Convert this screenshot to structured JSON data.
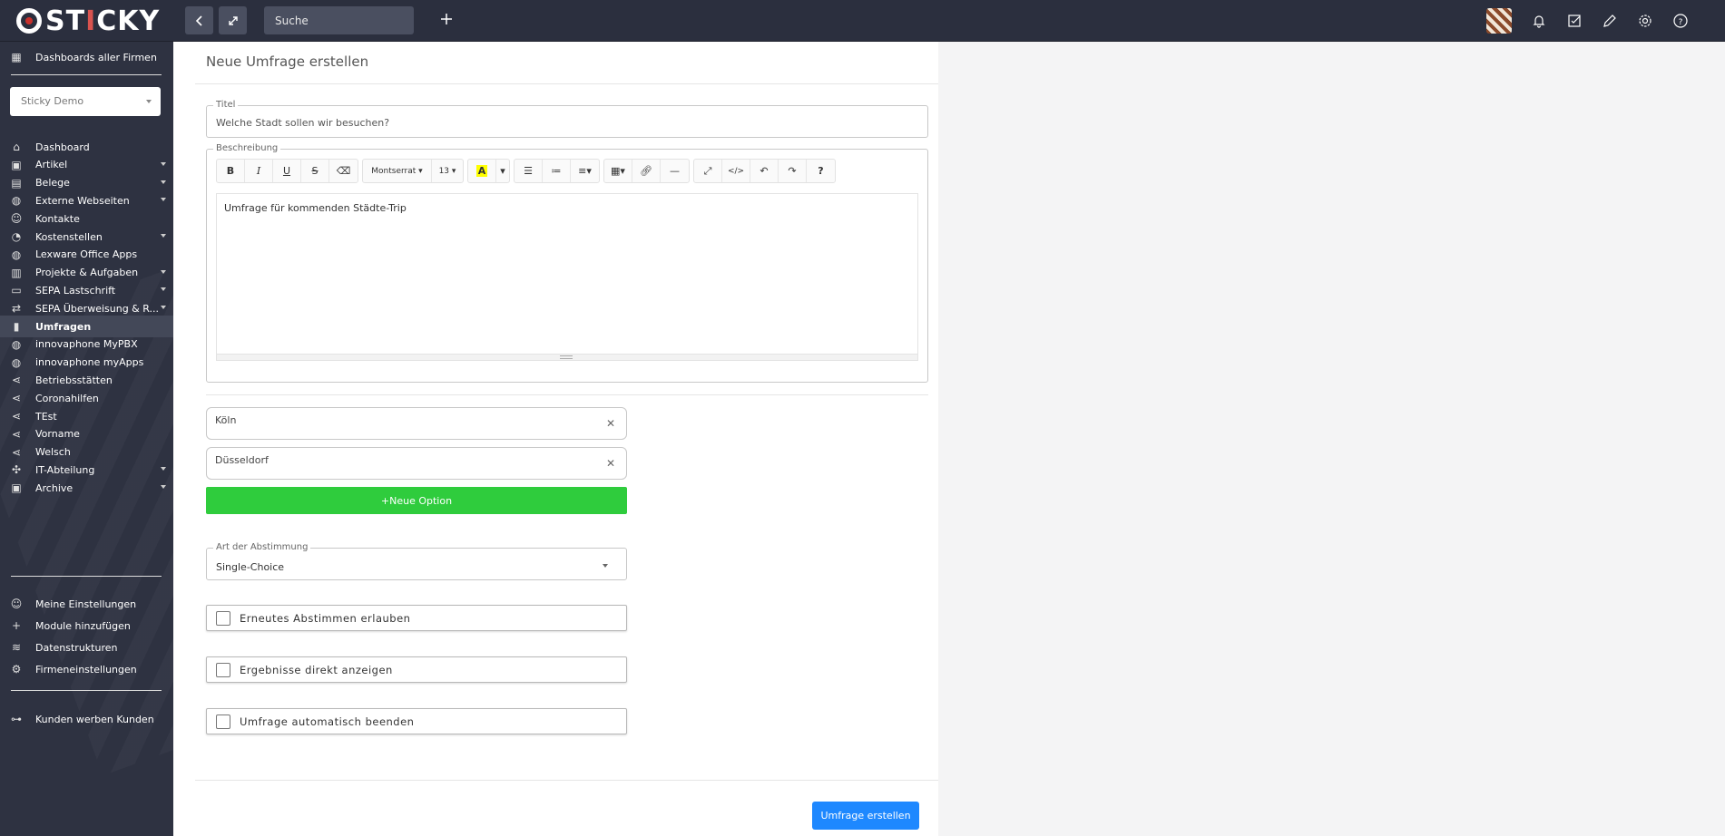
{
  "topbar": {
    "logo_text_a": "ST",
    "logo_text_b": "I",
    "logo_text_c": "CKY",
    "search_placeholder": "Suche",
    "icons": [
      "back-icon",
      "expand-icon",
      "plus-icon",
      "avatar",
      "bell-icon",
      "checkbox-icon",
      "pencil-icon",
      "gear-icon",
      "help-icon"
    ]
  },
  "sidebar": {
    "top_item": "Dashboards aller Firmen",
    "company": "Sticky Demo",
    "items": [
      {
        "label": "Dashboard",
        "icon": "home-icon",
        "caret": false
      },
      {
        "label": "Artikel",
        "icon": "box-icon",
        "caret": true
      },
      {
        "label": "Belege",
        "icon": "document-icon",
        "caret": true
      },
      {
        "label": "Externe Webseiten",
        "icon": "globe-icon",
        "caret": true
      },
      {
        "label": "Kontakte",
        "icon": "contact-icon",
        "caret": false
      },
      {
        "label": "Kostenstellen",
        "icon": "pie-icon",
        "caret": true
      },
      {
        "label": "Lexware Office Apps",
        "icon": "globe-icon",
        "caret": false
      },
      {
        "label": "Projekte & Aufgaben",
        "icon": "project-icon",
        "caret": true
      },
      {
        "label": "SEPA Lastschrift",
        "icon": "card-icon",
        "caret": true
      },
      {
        "label": "SEPA Überweisung & R...",
        "icon": "transfer-icon",
        "caret": true
      },
      {
        "label": "Umfragen",
        "icon": "chart-icon",
        "caret": false,
        "active": true
      },
      {
        "label": "innovaphone MyPBX",
        "icon": "globe-icon",
        "caret": false
      },
      {
        "label": "innovaphone myApps",
        "icon": "globe-icon",
        "caret": false
      },
      {
        "label": "Betriebsstätten",
        "icon": "share-icon",
        "caret": false
      },
      {
        "label": "Coronahilfen",
        "icon": "share-icon",
        "caret": false
      },
      {
        "label": "TEst",
        "icon": "share-icon",
        "caret": false
      },
      {
        "label": "Vorname",
        "icon": "share-icon",
        "caret": false
      },
      {
        "label": "Welsch",
        "icon": "share-icon",
        "caret": false
      },
      {
        "label": "IT-Abteilung",
        "icon": "network-icon",
        "caret": true
      },
      {
        "label": "Archive",
        "icon": "archive-icon",
        "caret": true
      }
    ],
    "bottom_items": [
      {
        "label": "Meine Einstellungen",
        "icon": "user-settings-icon"
      },
      {
        "label": "Module hinzufügen",
        "icon": "plus-icon"
      },
      {
        "label": "Datenstrukturen",
        "icon": "database-icon"
      },
      {
        "label": "Firmeneinstellungen",
        "icon": "gear-icon"
      }
    ],
    "referral": {
      "label": "Kunden werben Kunden",
      "icon": "hierarchy-icon"
    }
  },
  "form": {
    "page_title": "Neue Umfrage erstellen",
    "title_label": "Titel",
    "title_value": "Welche Stadt sollen wir besuchen?",
    "description_label": "Beschreibung",
    "toolbar": {
      "font_name": "Montserrat",
      "font_size": "13"
    },
    "description_text": "Umfrage für kommenden Städte-Trip",
    "options": [
      "Köln",
      "Düsseldorf"
    ],
    "new_option_label": "+Neue Option",
    "vote_type_label": "Art der Abstimmung",
    "vote_type_value": "Single-Choice",
    "checkboxes": [
      "Erneutes Abstimmen erlauben",
      "Ergebnisse direkt anzeigen",
      "Umfrage automatisch beenden"
    ],
    "submit_label": "Umfrage erstellen"
  },
  "colors": {
    "topbar": "#2b2f3e",
    "sidebar": "#2e3241",
    "new_option": "#2fcc3d",
    "submit": "#1e88ff"
  }
}
